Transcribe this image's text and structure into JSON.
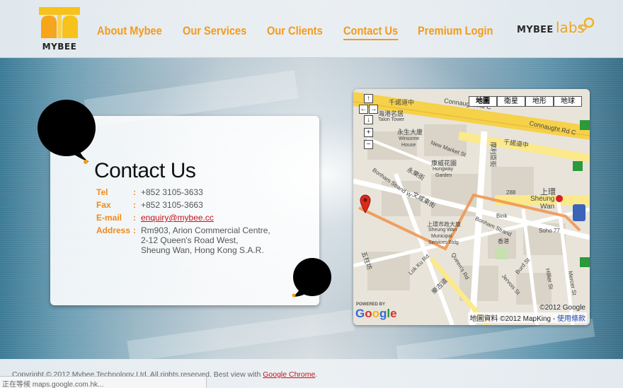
{
  "brand": {
    "logo_text": "MYBEE",
    "labs_prefix": "MYBEE",
    "labs_suffix": "labs"
  },
  "nav": {
    "items": [
      {
        "label": "About Mybee"
      },
      {
        "label": "Our Services"
      },
      {
        "label": "Our Clients"
      },
      {
        "label": "Contact Us",
        "active": true
      },
      {
        "label": "Premium Login"
      }
    ]
  },
  "contact": {
    "title": "Contact Us",
    "separator": ":",
    "tel_label": "Tel",
    "tel_value": "+852 3105-3633",
    "fax_label": "Fax",
    "fax_value": "+852 3105-3663",
    "email_label": "E-mail",
    "email_value": "enquiry@mybee.cc",
    "address_label": "Address",
    "address_lines": [
      "Rm903, Arion Commercial Centre,",
      "2-12 Queen's Road West,",
      "Sheung Wan, Hong Kong S.A.R."
    ]
  },
  "map": {
    "type_buttons": [
      "地圖",
      "衛星",
      "地形",
      "地球"
    ],
    "selected_type": "地圖",
    "labels": {
      "l1": "千諾道中",
      "l2": "Connaught Rd C",
      "l3": "千諾道中",
      "l4": "Connaught Rd C",
      "l5": "海港名居",
      "l6": "Talon Tower",
      "l7": "永生大廈",
      "l8": "Winsome",
      "l9": "House",
      "l10": "New Market St",
      "l11": "康威花園",
      "l12": "Hongway",
      "l13": "Garden",
      "l14": "永樂街",
      "l15": "Bonham Strand W",
      "l16": "文咸東街",
      "l17": "上環",
      "l18": "Sheung",
      "l19": "Wan",
      "l20": "Bonham Strand",
      "l21": "Soho 77",
      "l22": "上環市政大廈",
      "l23": "Sheung Wan",
      "l24": "Municipal",
      "l25": "Services Bldg",
      "l26": "Queen's Rd",
      "l27": "五柱坊",
      "l28": "Lok Ku Rd",
      "l29": "樂古道",
      "l30": "Burd St",
      "l31": "Jervois St",
      "l32": "Hillier St",
      "l33": "Mercer St",
      "l34": "摩利臣街",
      "l35": "Bink",
      "l36": "288",
      "l37": "香港"
    },
    "copyright": "©2012 Google",
    "attribution": "地圖資料 ©2012 MapKing - ",
    "terms_link": "使用條款",
    "powered": "POWERED BY",
    "google_letters": [
      "G",
      "o",
      "o",
      "g",
      "l",
      "e"
    ]
  },
  "footer": {
    "copyright": "Copyright © 2012 Mybee Technology Ltd. All rights reserved. Best view with ",
    "chrome_link": "Google Chrome",
    "period": "."
  },
  "status_bar": {
    "text": "正在等候 maps.google.com.hk..."
  },
  "colors": {
    "accent": "#f39a1d",
    "link_red": "#c4121a",
    "route": "#f0924a"
  }
}
